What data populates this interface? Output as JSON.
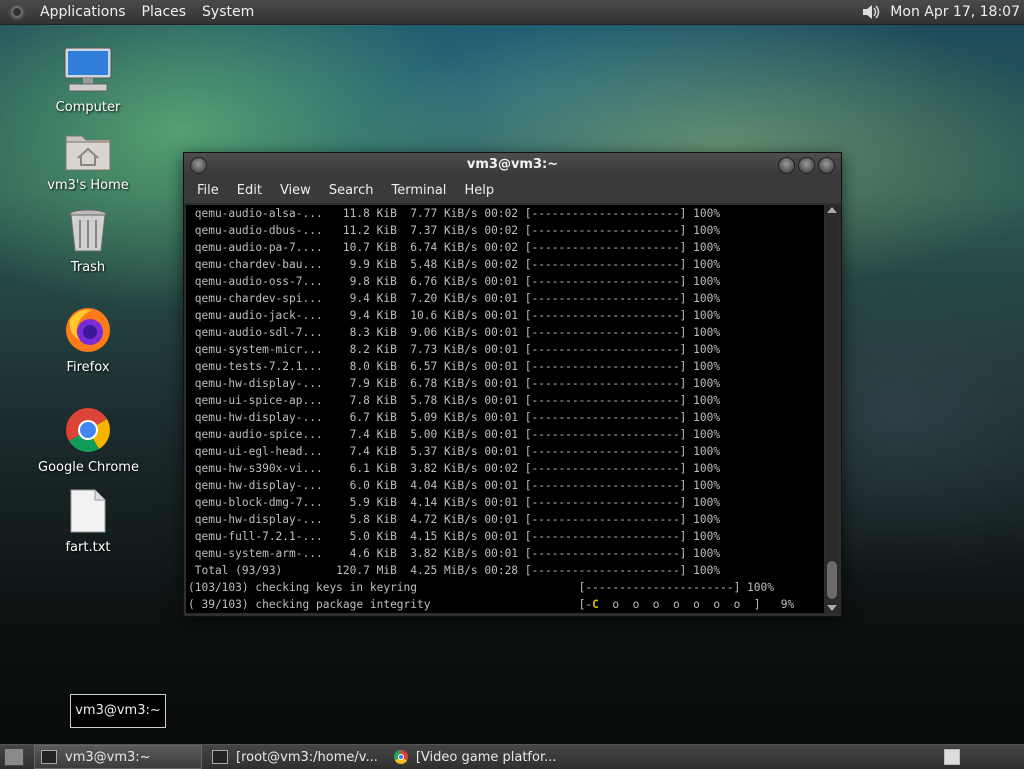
{
  "top_panel": {
    "menus": [
      "Applications",
      "Places",
      "System"
    ],
    "clock": "Mon Apr 17, 18:07",
    "volume_icon": "speaker-icon"
  },
  "desktop_icons": [
    {
      "label": "Computer",
      "icon": "computer-icon"
    },
    {
      "label": "vm3's Home",
      "icon": "home-folder-icon"
    },
    {
      "label": "Trash",
      "icon": "trash-icon"
    },
    {
      "label": "Firefox",
      "icon": "firefox-icon"
    },
    {
      "label": "Google Chrome",
      "icon": "chrome-icon"
    },
    {
      "label": "fart.txt",
      "icon": "text-file-icon"
    }
  ],
  "terminal": {
    "title": "vm3@vm3:~",
    "menu": [
      "File",
      "Edit",
      "View",
      "Search",
      "Terminal",
      "Help"
    ],
    "rows": [
      {
        "name": "qemu-audio-alsa-...",
        "size": "11.8 KiB",
        "speed": "7.77 KiB/s",
        "time": "00:02",
        "bar": "[----------------------]",
        "pct": "100%"
      },
      {
        "name": "qemu-audio-dbus-...",
        "size": "11.2 KiB",
        "speed": "7.37 KiB/s",
        "time": "00:02",
        "bar": "[----------------------]",
        "pct": "100%"
      },
      {
        "name": "qemu-audio-pa-7....",
        "size": "10.7 KiB",
        "speed": "6.74 KiB/s",
        "time": "00:02",
        "bar": "[----------------------]",
        "pct": "100%"
      },
      {
        "name": "qemu-chardev-bau...",
        "size": "9.9 KiB",
        "speed": "5.48 KiB/s",
        "time": "00:02",
        "bar": "[----------------------]",
        "pct": "100%"
      },
      {
        "name": "qemu-audio-oss-7...",
        "size": "9.8 KiB",
        "speed": "6.76 KiB/s",
        "time": "00:01",
        "bar": "[----------------------]",
        "pct": "100%"
      },
      {
        "name": "qemu-chardev-spi...",
        "size": "9.4 KiB",
        "speed": "7.20 KiB/s",
        "time": "00:01",
        "bar": "[----------------------]",
        "pct": "100%"
      },
      {
        "name": "qemu-audio-jack-...",
        "size": "9.4 KiB",
        "speed": "10.6 KiB/s",
        "time": "00:01",
        "bar": "[----------------------]",
        "pct": "100%"
      },
      {
        "name": "qemu-audio-sdl-7...",
        "size": "8.3 KiB",
        "speed": "9.06 KiB/s",
        "time": "00:01",
        "bar": "[----------------------]",
        "pct": "100%"
      },
      {
        "name": "qemu-system-micr...",
        "size": "8.2 KiB",
        "speed": "7.73 KiB/s",
        "time": "00:01",
        "bar": "[----------------------]",
        "pct": "100%"
      },
      {
        "name": "qemu-tests-7.2.1...",
        "size": "8.0 KiB",
        "speed": "6.57 KiB/s",
        "time": "00:01",
        "bar": "[----------------------]",
        "pct": "100%"
      },
      {
        "name": "qemu-hw-display-...",
        "size": "7.9 KiB",
        "speed": "6.78 KiB/s",
        "time": "00:01",
        "bar": "[----------------------]",
        "pct": "100%"
      },
      {
        "name": "qemu-ui-spice-ap...",
        "size": "7.8 KiB",
        "speed": "5.78 KiB/s",
        "time": "00:01",
        "bar": "[----------------------]",
        "pct": "100%"
      },
      {
        "name": "qemu-hw-display-...",
        "size": "6.7 KiB",
        "speed": "5.09 KiB/s",
        "time": "00:01",
        "bar": "[----------------------]",
        "pct": "100%"
      },
      {
        "name": "qemu-audio-spice...",
        "size": "7.4 KiB",
        "speed": "5.00 KiB/s",
        "time": "00:01",
        "bar": "[----------------------]",
        "pct": "100%"
      },
      {
        "name": "qemu-ui-egl-head...",
        "size": "7.4 KiB",
        "speed": "5.37 KiB/s",
        "time": "00:01",
        "bar": "[----------------------]",
        "pct": "100%"
      },
      {
        "name": "qemu-hw-s390x-vi...",
        "size": "6.1 KiB",
        "speed": "3.82 KiB/s",
        "time": "00:02",
        "bar": "[----------------------]",
        "pct": "100%"
      },
      {
        "name": "qemu-hw-display-...",
        "size": "6.0 KiB",
        "speed": "4.04 KiB/s",
        "time": "00:01",
        "bar": "[----------------------]",
        "pct": "100%"
      },
      {
        "name": "qemu-block-dmg-7...",
        "size": "5.9 KiB",
        "speed": "4.14 KiB/s",
        "time": "00:01",
        "bar": "[----------------------]",
        "pct": "100%"
      },
      {
        "name": "qemu-hw-display-...",
        "size": "5.8 KiB",
        "speed": "4.72 KiB/s",
        "time": "00:01",
        "bar": "[----------------------]",
        "pct": "100%"
      },
      {
        "name": "qemu-full-7.2.1-...",
        "size": "5.0 KiB",
        "speed": "4.15 KiB/s",
        "time": "00:01",
        "bar": "[----------------------]",
        "pct": "100%"
      },
      {
        "name": "qemu-system-arm-...",
        "size": "4.6 KiB",
        "speed": "3.82 KiB/s",
        "time": "00:01",
        "bar": "[----------------------]",
        "pct": "100%"
      }
    ],
    "total": {
      "name": "Total (93/93)",
      "size": "120.7 MiB",
      "speed": "4.25 MiB/s",
      "time": "00:28",
      "bar": "[----------------------]",
      "pct": "100%"
    },
    "keyring_line": {
      "text": "(103/103) checking keys in keyring",
      "bar": "[----------------------]",
      "pct": "100%"
    },
    "integrity_line": {
      "text": "( 39/103) checking package integrity",
      "bar_prefix": "[-",
      "bar_highlight": "C",
      "bar_rest": "  o  o  o  o  o  o  o  ]",
      "pct": "9%"
    }
  },
  "tooltip": "vm3@vm3:~",
  "taskbar": {
    "tasks": [
      {
        "label": "vm3@vm3:~",
        "icon": "terminal-icon"
      },
      {
        "label": "[root@vm3:/home/v...",
        "icon": "terminal-icon"
      },
      {
        "label": "[Video game platfor...",
        "icon": "chrome-icon"
      }
    ]
  }
}
